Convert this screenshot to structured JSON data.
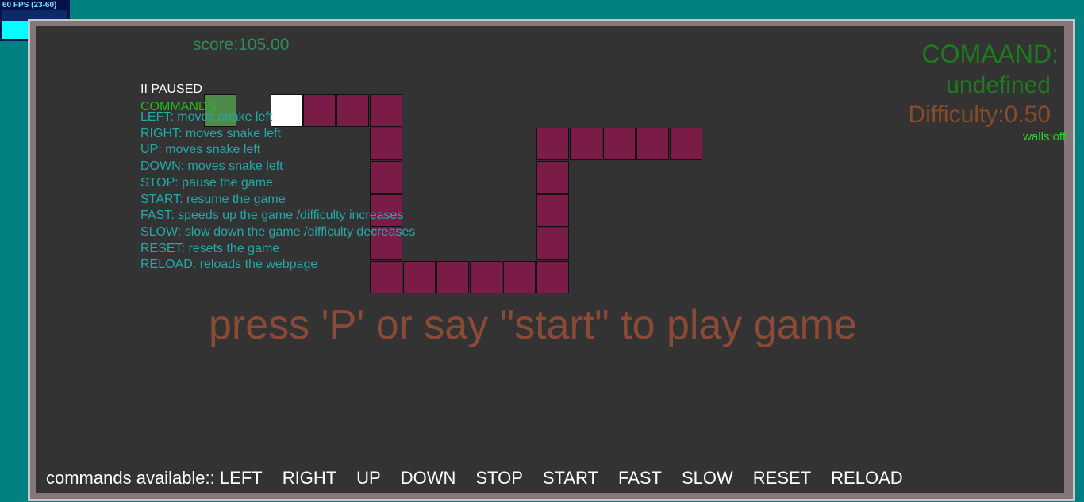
{
  "fps": {
    "label": "60 FPS (23-60)",
    "level": 0.6
  },
  "score": "score:105.00",
  "paused": "II PAUSED",
  "commands_heading": "COMMANDS",
  "help_lines": [
    "LEFT: moves snake left",
    "RIGHT: moves snake left",
    "UP: moves snake left",
    "DOWN: moves snake left",
    "STOP: pause the game",
    "START: resume the game",
    "FAST: speeds up the game /difficulty increases",
    "SLOW: slow down the game /difficulty decreases",
    "RESET: resets the game",
    "RELOAD: reloads the webpage"
  ],
  "command_label": "COMAAND:",
  "command_value": "undefined",
  "difficulty": "Difficulty:0.50",
  "walls": "walls:off",
  "prompt": "press 'P' or say \"start\" to play game",
  "available": {
    "prefix": "commands available::",
    "items": [
      "LEFT",
      "RIGHT",
      "UP",
      "DOWN",
      "STOP",
      "START",
      "FAST",
      "SLOW",
      "RESET",
      "RELOAD"
    ]
  },
  "colors": {
    "background": "#008080",
    "board": "#333333",
    "snake": "#7b1c48",
    "snake_head": "#ffffff",
    "food": "#4f8a4b"
  }
}
